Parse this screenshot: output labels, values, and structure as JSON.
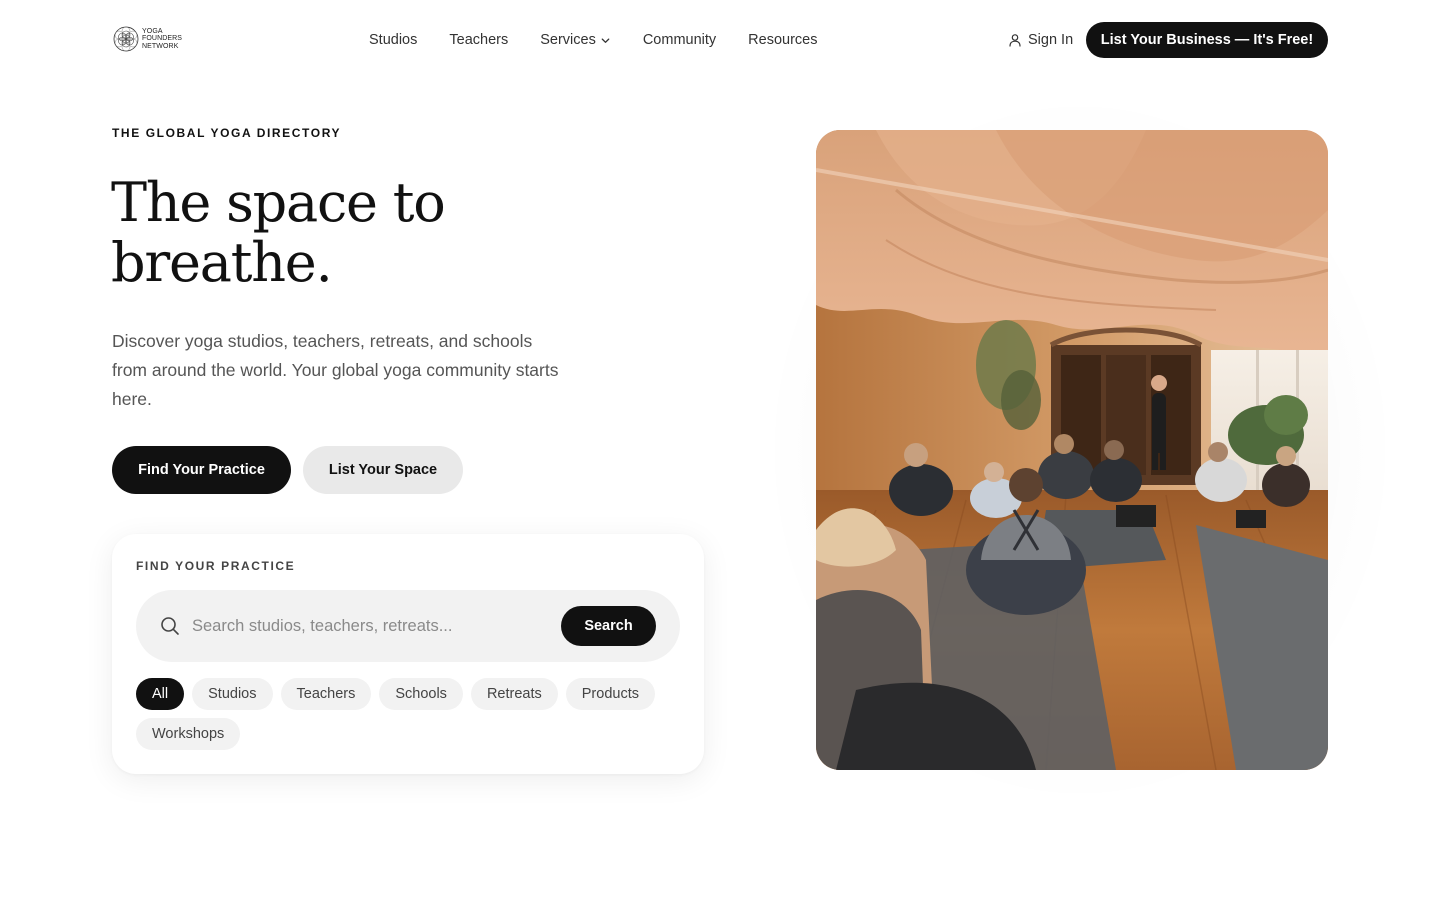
{
  "header": {
    "logo": {
      "icon": "flower-of-life-icon",
      "lines": [
        "YOGA",
        "FOUNDERS",
        "NETWORK"
      ]
    },
    "nav": [
      {
        "label": "Studios",
        "dropdown": false
      },
      {
        "label": "Teachers",
        "dropdown": false
      },
      {
        "label": "Services",
        "dropdown": true,
        "icon": "chevron-down-icon"
      },
      {
        "label": "Community",
        "dropdown": false
      },
      {
        "label": "Resources",
        "dropdown": false
      }
    ],
    "sign_in": {
      "label": "Sign In",
      "icon": "user-icon"
    },
    "cta_label": "List Your Business — It's Free!"
  },
  "hero": {
    "eyebrow": "THE GLOBAL YOGA DIRECTORY",
    "title_line1": "The space to",
    "title_line2": "breathe.",
    "description": "Discover yoga studios, teachers, retreats, and schools from around the world. Your global yoga community starts here.",
    "primary_button": "Find Your Practice",
    "secondary_button": "List Your Space",
    "image": {
      "icon": "yoga-class-photo"
    }
  },
  "search_card": {
    "label": "FIND YOUR PRACTICE",
    "placeholder": "Search studios, teachers, retreats...",
    "value": "",
    "search_icon": "search-icon",
    "button": "Search",
    "chips": [
      {
        "label": "All",
        "active": true
      },
      {
        "label": "Studios",
        "active": false
      },
      {
        "label": "Teachers",
        "active": false
      },
      {
        "label": "Schools",
        "active": false
      },
      {
        "label": "Retreats",
        "active": false
      },
      {
        "label": "Products",
        "active": false
      },
      {
        "label": "Workshops",
        "active": false
      }
    ]
  },
  "colors": {
    "primary": "#111111",
    "secondary_button_bg": "#e9e9e9",
    "chip_bg": "#f2f2f2",
    "body_text": "#555555",
    "background": "#ffffff"
  }
}
